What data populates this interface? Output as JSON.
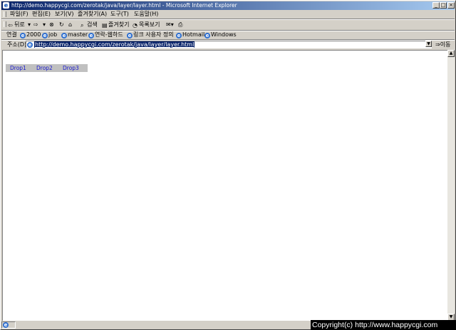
{
  "window": {
    "title": "http://demo.happycgi.com/zerotak/java/layer/layer.html - Microsoft Internet Explorer",
    "min_glyph": "_",
    "max_glyph": "□",
    "close_glyph": "×"
  },
  "menubar": {
    "items": [
      "파일(F)",
      "편집(E)",
      "보기(V)",
      "즐겨찾기(A)",
      "도구(T)",
      "도움말(H)"
    ]
  },
  "toolbar": {
    "back_label": "뒤로",
    "search_label": "검색",
    "favorites_label": "즐겨찾기",
    "history_label": "목록보기"
  },
  "links": {
    "label": "연결",
    "items": [
      "2000",
      "job",
      "master",
      "연락-웹하드",
      "링크 사용자 정의",
      "Hotmail",
      "Windows"
    ]
  },
  "address": {
    "label": "주소(D)",
    "url": "http://demo.happycgi.com/zerotak/java/layer/layer.html",
    "go_label": "이동"
  },
  "page": {
    "drop_items": [
      "Drop1",
      "Drop2",
      "Drop3"
    ]
  },
  "overlay": {
    "copyright": "Copyright(c) http://www.happycgi.com"
  },
  "colors": {
    "titlebar": "#0a246a",
    "link": "#1a1ad0",
    "menu_bg": "#c0c0c0"
  }
}
